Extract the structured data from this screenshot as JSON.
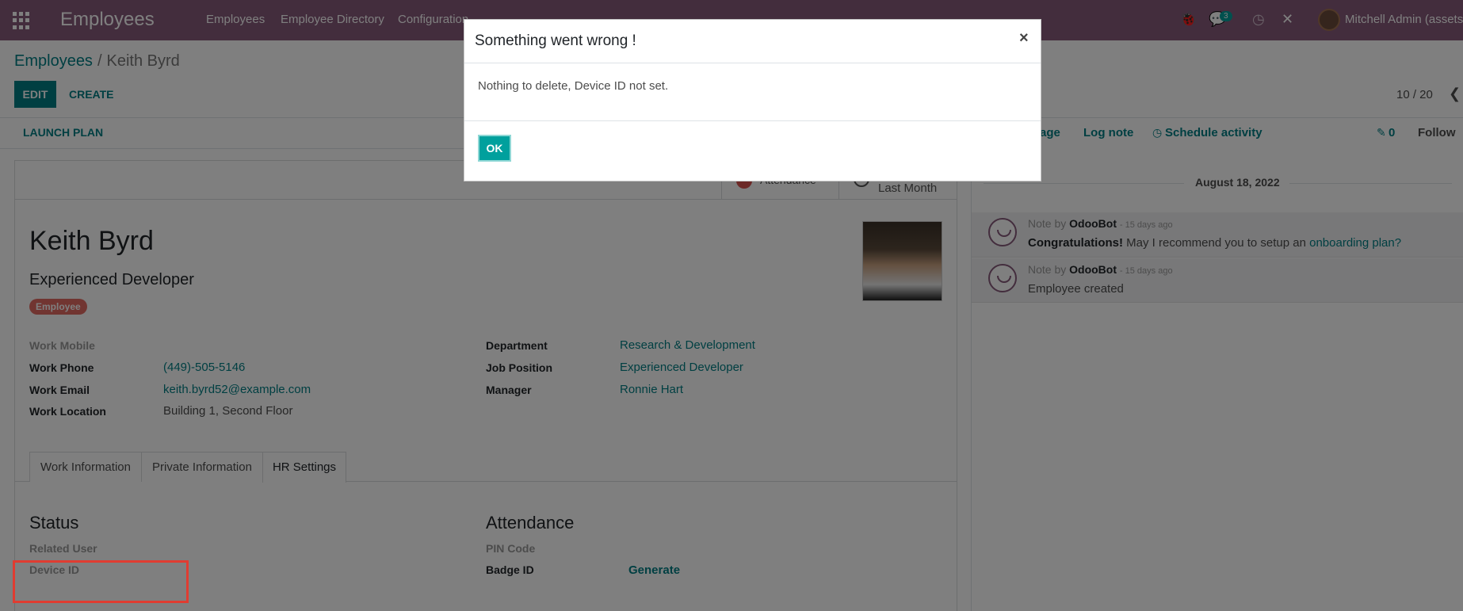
{
  "topbar": {
    "app_title": "Employees",
    "nav": [
      "Employees",
      "Employee Directory",
      "Configuration"
    ],
    "messages_count": "3",
    "user_name": "Mitchell Admin (assets"
  },
  "control_panel": {
    "breadcrumb_root": "Employees",
    "breadcrumb_sep": "/",
    "breadcrumb_current": "Keith Byrd",
    "edit_label": "EDIT",
    "create_label": "CREATE",
    "pager": "10 / 20"
  },
  "statusbar": {
    "launch_plan": "LAUNCH PLAN"
  },
  "smart_buttons": {
    "attendance": "Attendance",
    "last_month": "Last Month"
  },
  "employee": {
    "name": "Keith Byrd",
    "job_title": "Experienced Developer",
    "tag": "Employee",
    "fields_left": [
      {
        "label": "Work Mobile",
        "value": ""
      },
      {
        "label": "Work Phone",
        "value": "(449)-505-5146"
      },
      {
        "label": "Work Email",
        "value": "keith.byrd52@example.com"
      },
      {
        "label": "Work Location",
        "value": "Building 1, Second Floor"
      }
    ],
    "fields_right": [
      {
        "label": "Department",
        "value": "Research & Development"
      },
      {
        "label": "Job Position",
        "value": "Experienced Developer"
      },
      {
        "label": "Manager",
        "value": "Ronnie Hart"
      }
    ]
  },
  "tabs": [
    {
      "label": "Work Information"
    },
    {
      "label": "Private Information"
    },
    {
      "label": "HR Settings",
      "active": true
    }
  ],
  "hr_settings": {
    "status_title": "Status",
    "related_user_label": "Related User",
    "device_id_label": "Device ID",
    "attendance_title": "Attendance",
    "pin_code_label": "PIN Code",
    "badge_id_label": "Badge ID",
    "generate_label": "Generate"
  },
  "chatter": {
    "send_message_partial": "age",
    "log_note": "Log note",
    "schedule_activity": "Schedule activity",
    "attachments_count": "0",
    "follow": "Follow",
    "date_separator": "August 18, 2022",
    "messages": [
      {
        "prefix": "Note by",
        "author": "OdooBot",
        "when": "- 15 days ago",
        "bold_lead": "Congratulations!",
        "text": " May I recommend you to setup an ",
        "link": "onboarding plan?"
      },
      {
        "prefix": "Note by",
        "author": "OdooBot",
        "when": "- 15 days ago",
        "bold_lead": "",
        "text": "Employee created",
        "link": ""
      }
    ]
  },
  "dialog": {
    "title": "Something went wrong !",
    "close": "×",
    "body": "Nothing to delete, Device ID not set.",
    "ok_label": "OK"
  },
  "colors": {
    "brand": "#875a7b",
    "accent": "#017e84",
    "ok_button": "#00a09d",
    "tag": "#e36a63",
    "highlight": "#e03c31"
  }
}
